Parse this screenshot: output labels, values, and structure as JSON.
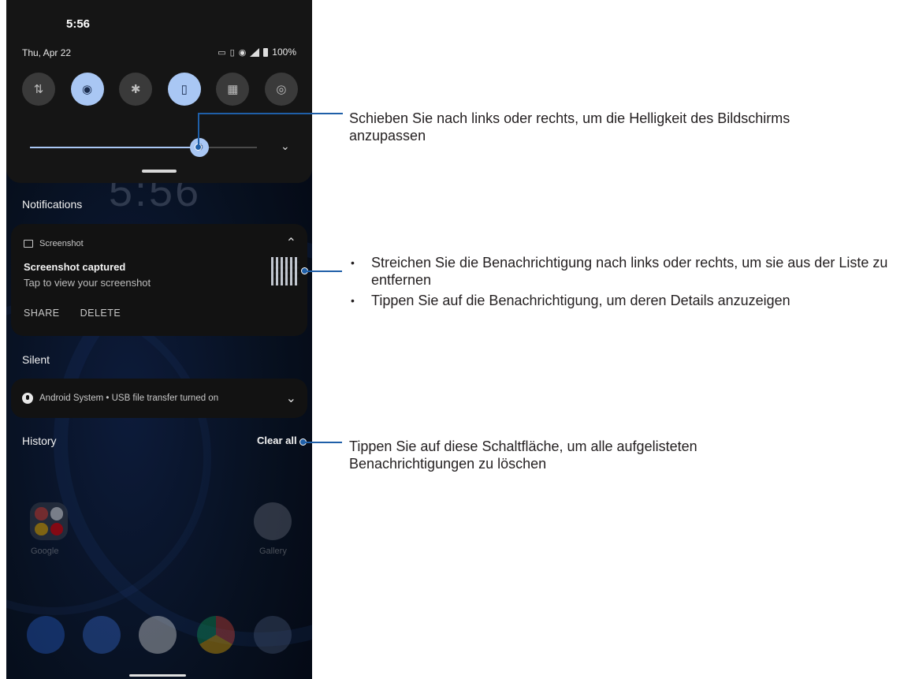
{
  "status_bar": {
    "time": "5:56",
    "date": "Thu, Apr 22",
    "battery": "100%"
  },
  "quick_settings": {
    "tiles": [
      {
        "name": "mobile-data",
        "glyph": "⇅",
        "active": false
      },
      {
        "name": "wifi",
        "glyph": "◉",
        "active": true
      },
      {
        "name": "bluetooth",
        "glyph": "✱",
        "active": false
      },
      {
        "name": "vibrate",
        "glyph": "▯",
        "active": true
      },
      {
        "name": "qr-code",
        "glyph": "▦",
        "active": false
      },
      {
        "name": "hotspot",
        "glyph": "◎",
        "active": false
      }
    ],
    "brightness_level": 0.74,
    "expand_glyph": "⌄"
  },
  "lock_clock": "5:56",
  "notifications": {
    "section_title": "Notifications",
    "screenshot": {
      "app": "Screenshot",
      "title": "Screenshot captured",
      "subtitle": "Tap to view your screenshot",
      "action_share": "SHARE",
      "action_delete": "DELETE",
      "collapse_glyph": "⌃"
    },
    "silent_title": "Silent",
    "android_system": {
      "text": "Android System • USB file transfer turned on",
      "expand_glyph": "⌄"
    },
    "history_title": "History",
    "clear_all": "Clear all"
  },
  "home": {
    "folder_label": "Google",
    "gallery_label": "Gallery"
  },
  "annotations": {
    "brightness": "Schieben Sie nach links oder rechts, um die Helligkeit des Bildschirms anzupassen",
    "swipe": "Streichen Sie die Benachrichtigung nach links oder rechts, um sie aus der Liste zu entfernen",
    "tap": "Tippen Sie auf die Benachrichtigung, um deren Details anzuzeigen",
    "clear_all": "Tippen Sie auf diese Schaltfläche, um alle aufgelisteten Benachrichtigungen zu löschen"
  },
  "colors": {
    "accent": "#a9c7f4",
    "callout": "#1f5fa8"
  }
}
